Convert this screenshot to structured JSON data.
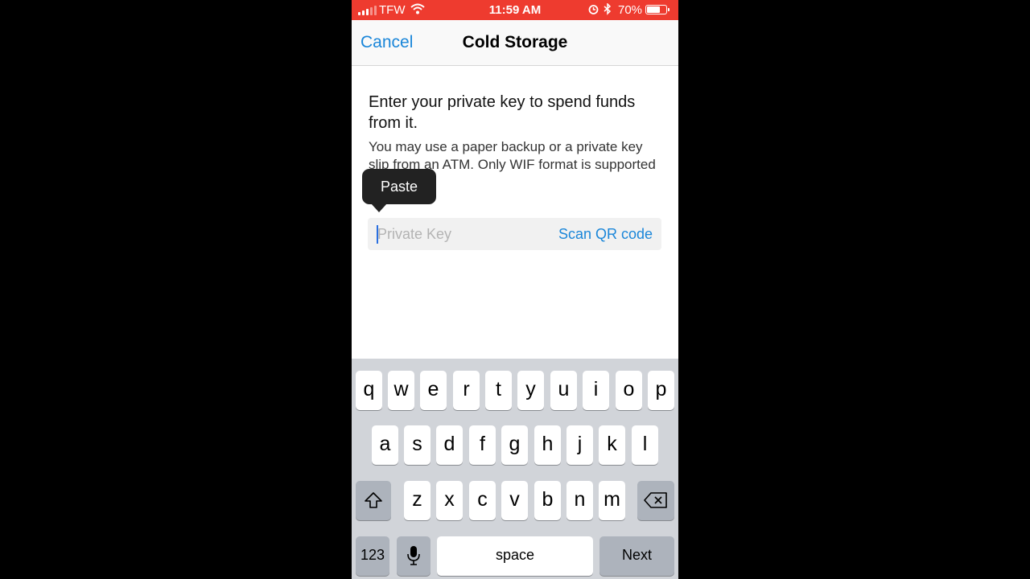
{
  "status_bar": {
    "carrier": "TFW",
    "time": "11:59 AM",
    "battery_percent": "70%",
    "battery_level": 0.7,
    "icons": [
      "signal-icon",
      "wifi-icon",
      "alarm-icon",
      "bluetooth-icon",
      "battery-icon"
    ]
  },
  "nav": {
    "cancel_label": "Cancel",
    "title": "Cold Storage"
  },
  "content": {
    "headline": "Enter your private key to spend funds from it.",
    "description": "You may use a paper backup or a private key slip from an ATM. Only WIF format is supported for now.",
    "paste_label": "Paste",
    "private_key_placeholder": "Private Key",
    "private_key_value": "",
    "scan_label": "Scan QR code"
  },
  "keyboard": {
    "row1": [
      "q",
      "w",
      "e",
      "r",
      "t",
      "y",
      "u",
      "i",
      "o",
      "p"
    ],
    "row2": [
      "a",
      "s",
      "d",
      "f",
      "g",
      "h",
      "j",
      "k",
      "l"
    ],
    "row3": [
      "z",
      "x",
      "c",
      "v",
      "b",
      "n",
      "m"
    ],
    "numbers_label": "123",
    "space_label": "space",
    "next_label": "Next"
  },
  "colors": {
    "status_bar": "#ee3b2f",
    "accent": "#1a86d9"
  }
}
